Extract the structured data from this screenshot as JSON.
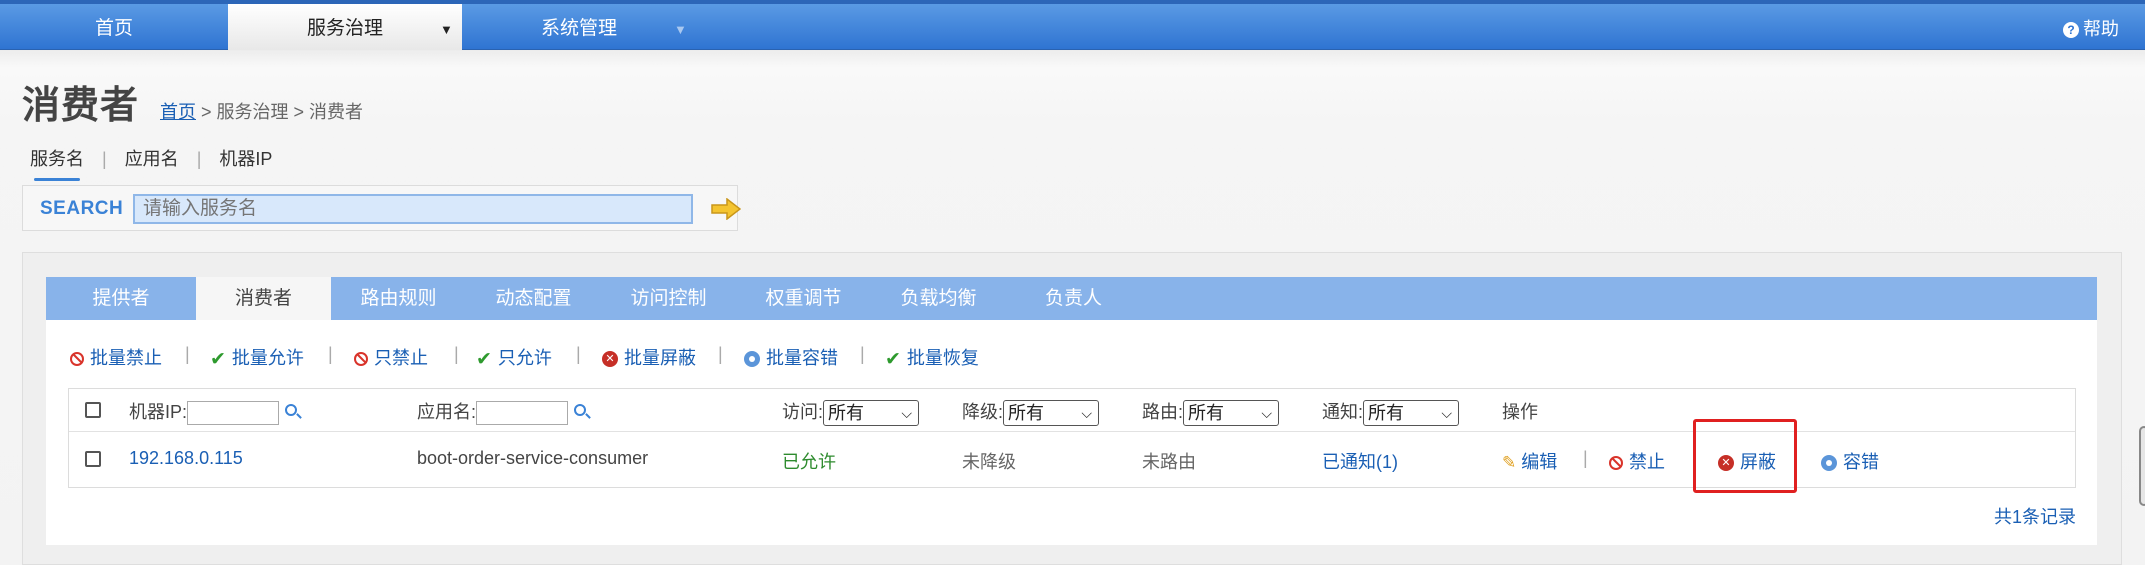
{
  "nav": {
    "items": [
      {
        "label": "首页"
      },
      {
        "label": "服务治理"
      },
      {
        "label": "系统管理"
      }
    ],
    "help_label": "帮助"
  },
  "page": {
    "title": "消费者",
    "breadcrumb": {
      "home": "首页",
      "rest": " > 服务治理 > 消费者"
    }
  },
  "search": {
    "tabs": [
      "服务名",
      "应用名",
      "机器IP"
    ],
    "label": "SEARCH",
    "placeholder": "请输入服务名"
  },
  "tabs": [
    "提供者",
    "消费者",
    "路由规则",
    "动态配置",
    "访问控制",
    "权重调节",
    "负载均衡",
    "负责人"
  ],
  "actions": [
    "批量禁止",
    "批量允许",
    "只禁止",
    "只允许",
    "批量屏蔽",
    "批量容错",
    "批量恢复"
  ],
  "table": {
    "headers": {
      "ip_label": "机器IP:",
      "app_label": "应用名:",
      "access_label": "访问:",
      "degrade_label": "降级:",
      "route_label": "路由:",
      "notify_label": "通知:",
      "ops_label": "操作",
      "filter_value": "所有"
    },
    "rows": [
      {
        "ip": "192.168.0.115",
        "app": "boot-order-service-consumer",
        "access": "已允许",
        "degrade": "未降级",
        "route": "未路由",
        "notify": "已通知(1)",
        "ops": [
          "编辑",
          "禁止",
          "屏蔽",
          "容错"
        ]
      }
    ]
  },
  "footer": {
    "count": "共1条记录"
  },
  "colors": {
    "nav_blue": "#2f74d2",
    "tab_blue": "#88b3ea",
    "link": "#1a5fb4",
    "green": "#2e8b2e",
    "highlight": "#e02020"
  }
}
